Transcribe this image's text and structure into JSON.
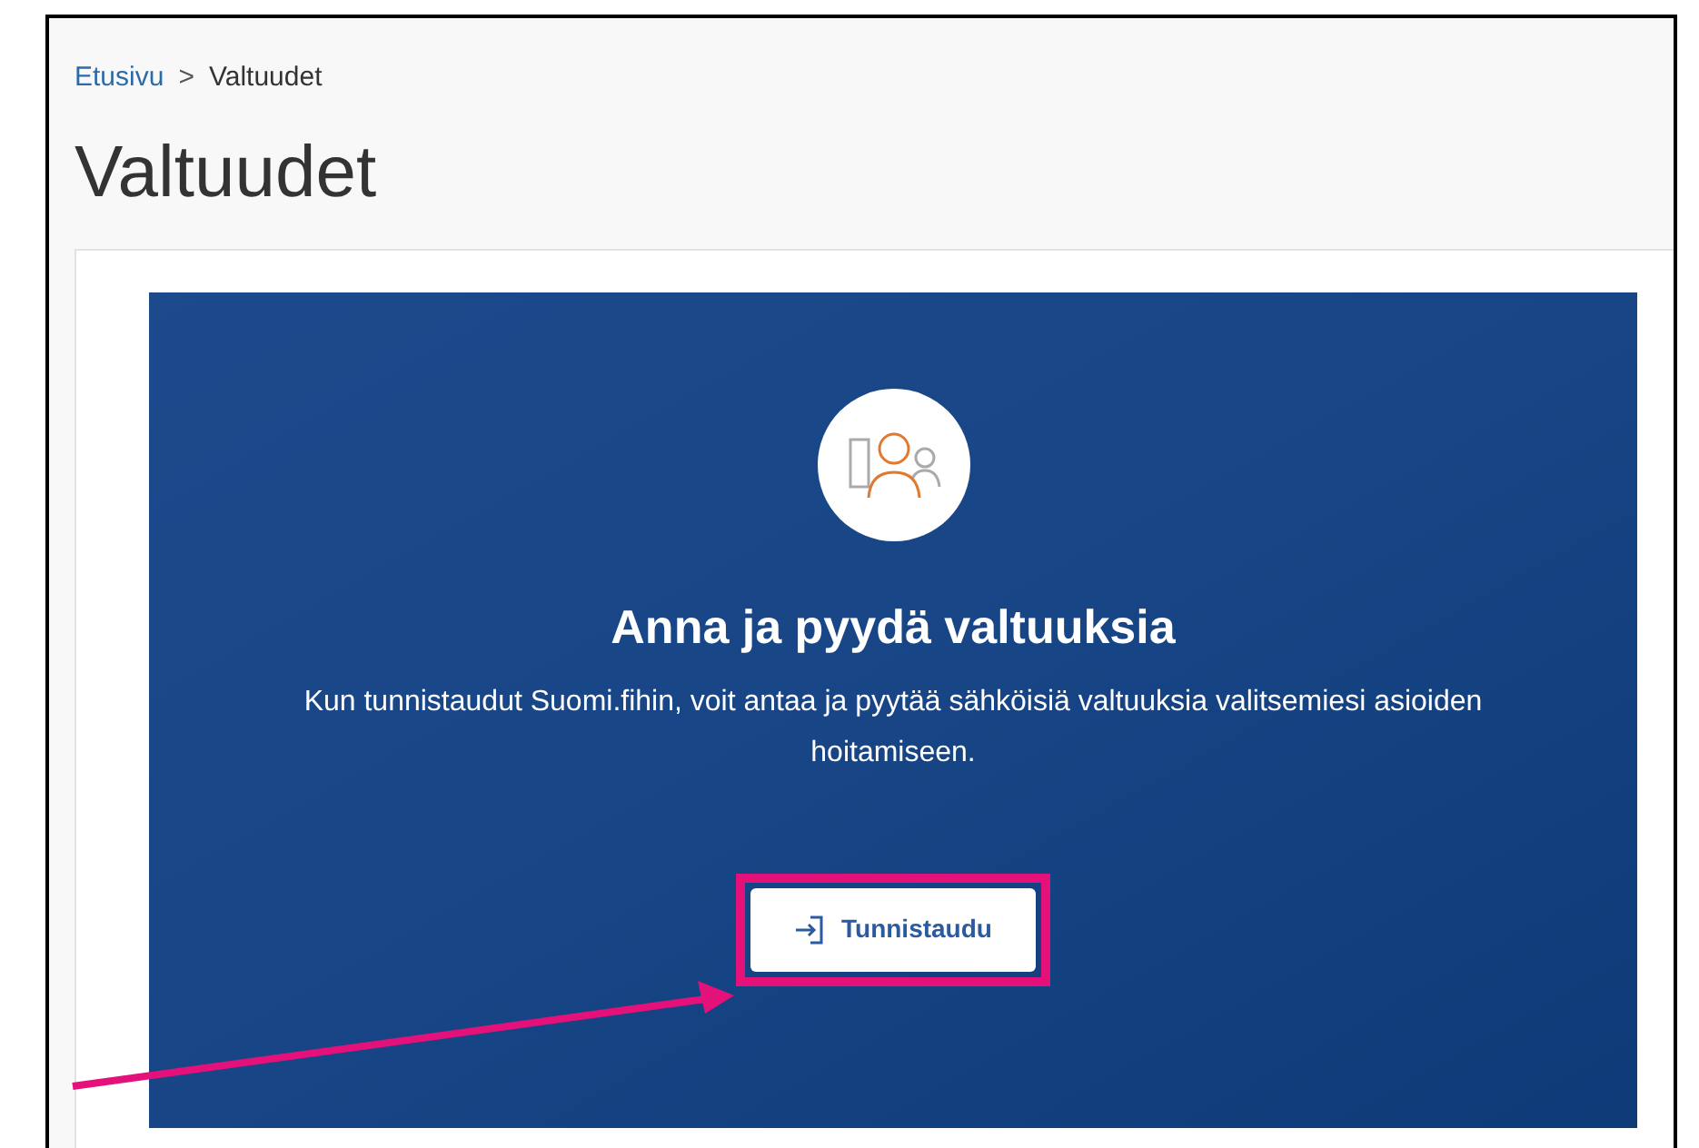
{
  "breadcrumb": [
    {
      "label": "Etusivu",
      "kind": "link"
    },
    {
      "label": ">",
      "kind": "separator"
    },
    {
      "label": "Valtuudet",
      "kind": "current"
    }
  ],
  "title": "Valtuudet",
  "hero": {
    "heading": "Anna ja pyydä valtuuksia",
    "text": "Kun tunnistaudut Suomi.fihin, voit antaa ja pyytää sähköisiä valtuuksia valitsemiesi asioiden hoitamiseen.",
    "button": "Tunnistaudu"
  }
}
